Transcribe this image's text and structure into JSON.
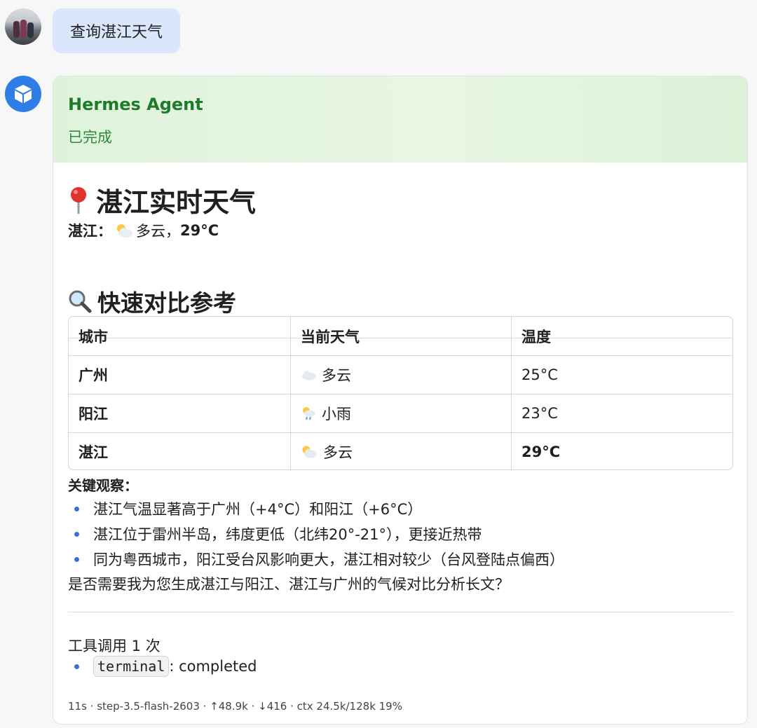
{
  "user_message": {
    "text": "查询湛江天气"
  },
  "agent": {
    "name": "Hermes Agent",
    "status": "已完成"
  },
  "weather": {
    "title": "湛江实时天气",
    "title_icon": "round-pushpin-icon",
    "city_label": "湛江：",
    "condition": "多云，",
    "temp": "29°C",
    "condition_icon": "partly-cloudy-icon"
  },
  "compare": {
    "title": "快速对比参考",
    "title_icon": "magnifier-icon",
    "headers": [
      "城市",
      "当前天气",
      "温度"
    ],
    "rows": [
      {
        "city": "广州",
        "weather": "多云",
        "icon": "cloud-icon",
        "temp": "25°C"
      },
      {
        "city": "阳江",
        "weather": "小雨",
        "icon": "sun-rain-icon",
        "temp": "23°C"
      },
      {
        "city": "湛江",
        "weather": "多云",
        "icon": "partly-cloudy-icon",
        "temp": "29°C"
      }
    ]
  },
  "observations": {
    "title": "关键观察：",
    "items": [
      "湛江气温显著高于广州（+4°C）和阳江（+6°C）",
      "湛江位于雷州半岛，纬度更低（北纬20°-21°），更接近热带",
      "同为粤西城市，阳江受台风影响更大，湛江相对较少（台风登陆点偏西）"
    ],
    "question": "是否需要我为您生成湛江与阳江、湛江与广州的气候对比分析长文？"
  },
  "tools": {
    "title": "工具调用 1 次",
    "items": [
      {
        "name": "terminal",
        "status": ": completed"
      }
    ]
  },
  "footer": {
    "text": "11s · step-3.5-flash-2603 · ↑48.9k · ↓416 · ctx 24.5k/128k 19%"
  },
  "colors": {
    "accent": "#2f7ee8",
    "header_green": "#1f7a2a",
    "bullet": "#3b6fd8",
    "user_bubble": "#d9e6fb"
  }
}
